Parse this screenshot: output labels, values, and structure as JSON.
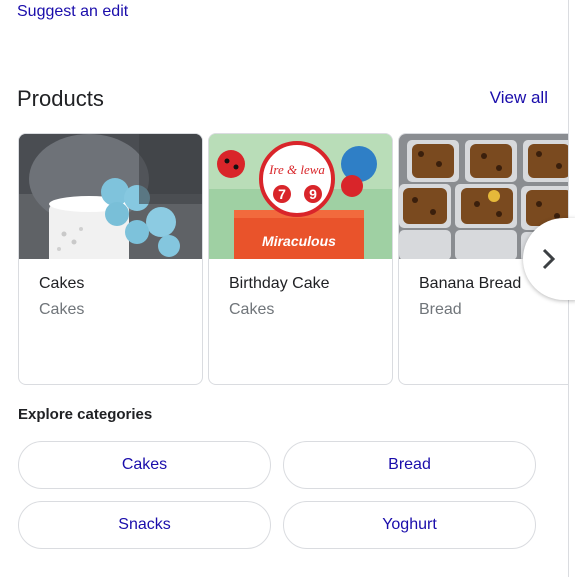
{
  "links": {
    "suggest_edit": "Suggest an edit",
    "view_all": "View all"
  },
  "products": {
    "title": "Products",
    "items": [
      {
        "title": "Cakes",
        "category": "Cakes"
      },
      {
        "title": "Birthday Cake",
        "category": "Cakes"
      },
      {
        "title": "Banana Bread",
        "category": "Bread"
      }
    ]
  },
  "images": {
    "cake2_topper_text": "Ire & lewa",
    "cake2_number": "7",
    "cake2_number2": "9",
    "cake2_brand": "Miraculous"
  },
  "explore": {
    "title": "Explore categories",
    "chips": [
      "Cakes",
      "Bread",
      "Snacks",
      "Yoghurt"
    ]
  },
  "colors": {
    "link": "#1a0dab",
    "border": "#dadce0",
    "secondary_text": "#70757a"
  }
}
